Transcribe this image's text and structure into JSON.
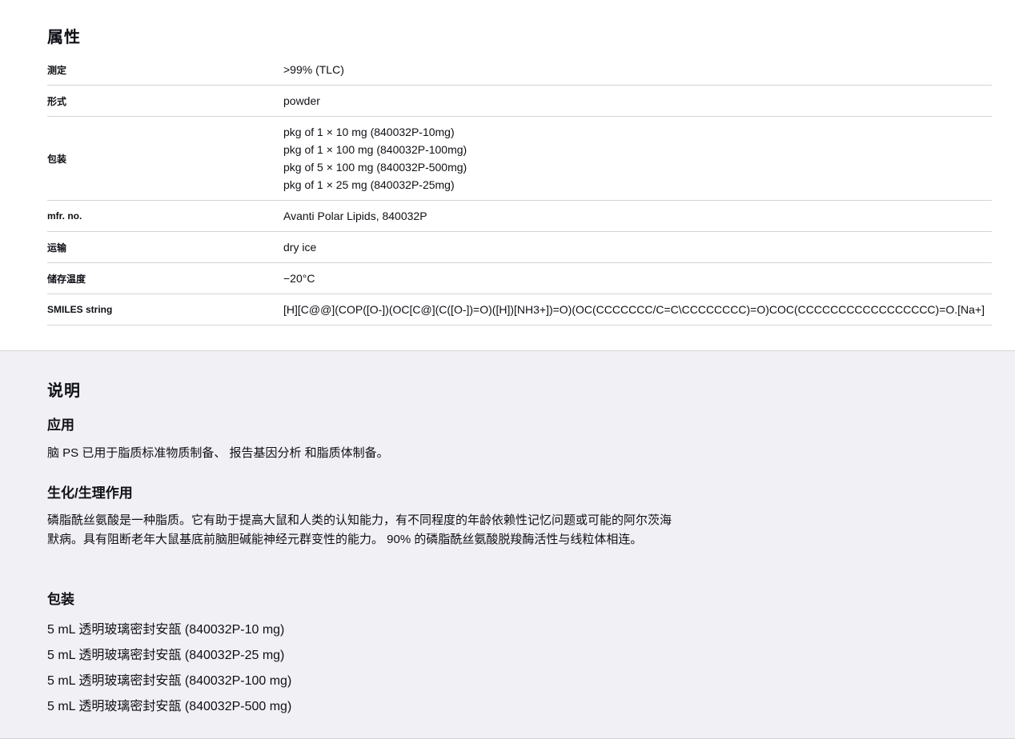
{
  "properties": {
    "title": "属性",
    "rows": [
      {
        "label": "测定",
        "values": [
          ">99% (TLC)"
        ]
      },
      {
        "label": "形式",
        "values": [
          "powder"
        ]
      },
      {
        "label": "包装",
        "values": [
          "pkg of 1 × 10 mg (840032P-10mg)",
          "pkg of 1 × 100 mg (840032P-100mg)",
          "pkg of 5 × 100 mg (840032P-500mg)",
          "pkg of 1 × 25 mg (840032P-25mg)"
        ]
      },
      {
        "label": "mfr. no.",
        "values": [
          "Avanti Polar Lipids, 840032P"
        ]
      },
      {
        "label": "运输",
        "values": [
          "dry ice"
        ]
      },
      {
        "label": "储存温度",
        "values": [
          "−20°C"
        ]
      },
      {
        "label": "SMILES string",
        "values": [
          "[H][C@@](COP([O-])(OC[C@](C([O-])=O)([H])[NH3+])=O)(OC(CCCCCCC/C=C\\CCCCCCCC)=O)COC(CCCCCCCCCCCCCCCCC)=O.[Na+]"
        ]
      }
    ]
  },
  "description": {
    "title": "说明",
    "application": {
      "heading": "应用",
      "text": "脑 PS 已用于脂质标准物质制备、 报告基因分析 和脂质体制备。"
    },
    "biochem": {
      "heading": "生化/生理作用",
      "text": "磷脂酰丝氨酸是一种脂质。它有助于提高大鼠和人类的认知能力，有不同程度的年龄依赖性记忆问题或可能的阿尔茨海默病。具有阻断老年大鼠基底前脑胆碱能神经元群变性的能力。 90% 的磷脂酰丝氨酸脱羧酶活性与线粒体相连。"
    },
    "packaging": {
      "heading": "包装",
      "items": [
        "5 mL 透明玻璃密封安瓿 (840032P-10 mg)",
        "5 mL 透明玻璃密封安瓿 (840032P-25 mg)",
        "5 mL 透明玻璃密封安瓿 (840032P-100 mg)",
        "5 mL 透明玻璃密封安瓿 (840032P-500 mg)"
      ]
    }
  }
}
